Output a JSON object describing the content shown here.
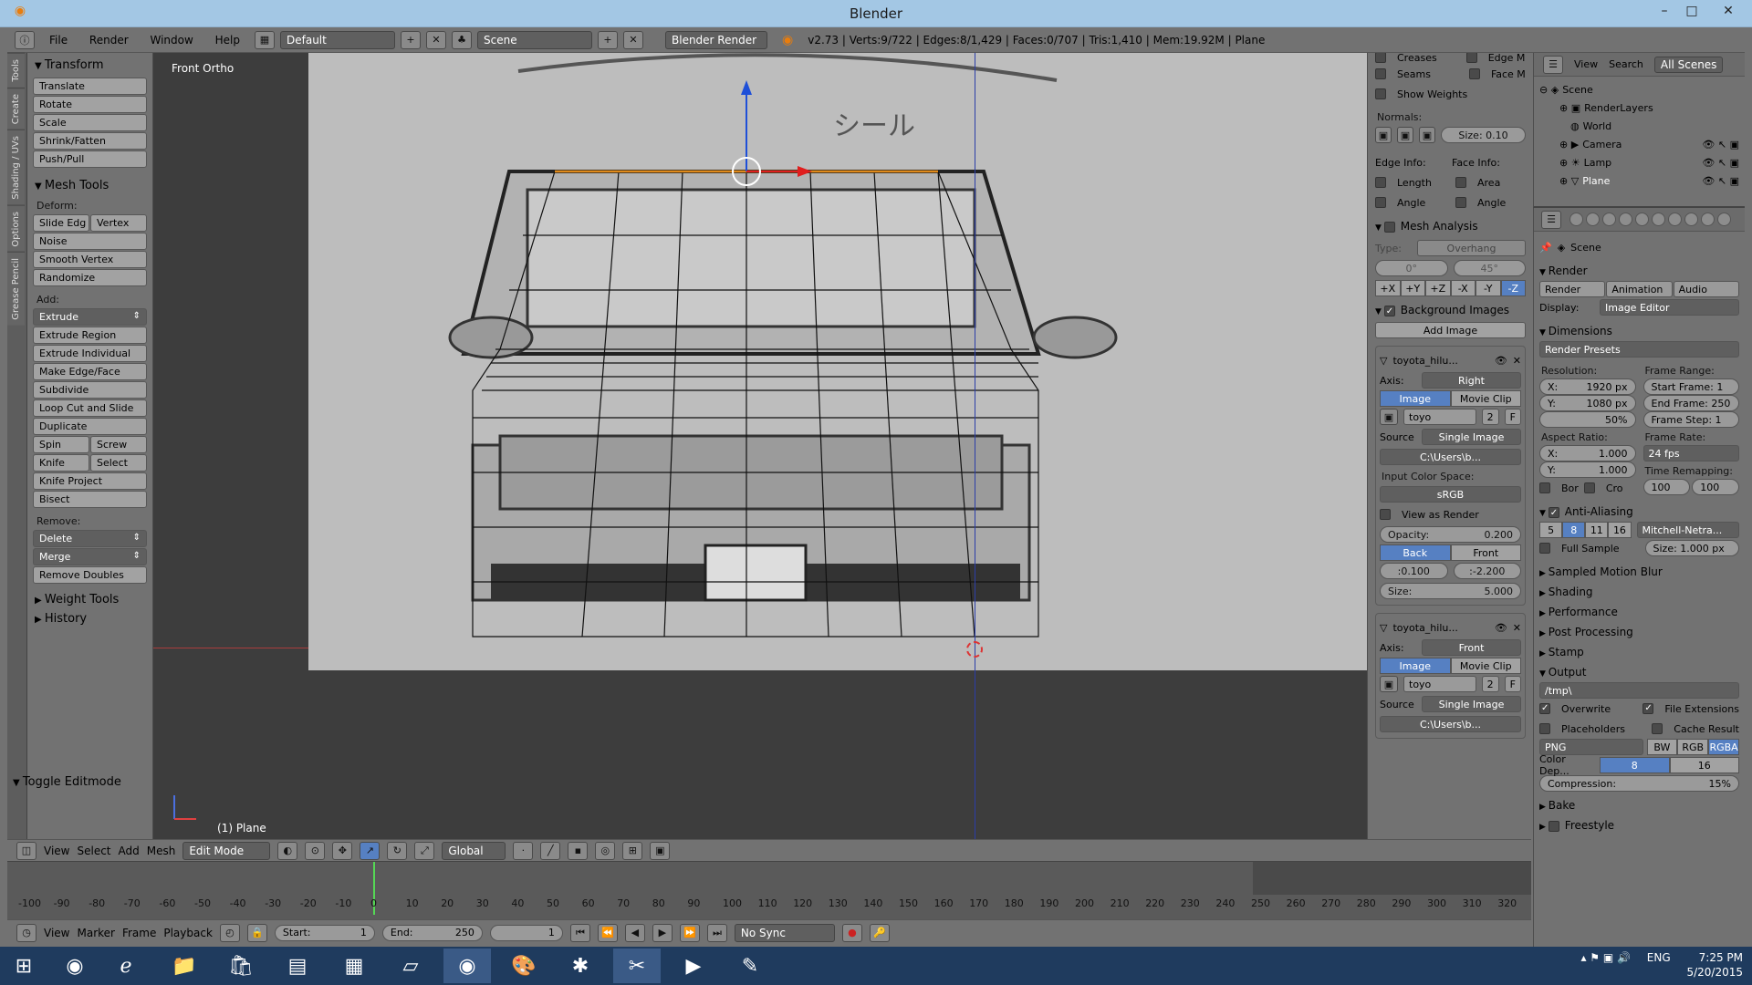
{
  "window": {
    "title": "Blender"
  },
  "infobar": {
    "menus": [
      "File",
      "Render",
      "Window",
      "Help"
    ],
    "layout": "Default",
    "scene": "Scene",
    "engine": "Blender Render",
    "stats": "v2.73 | Verts:9/722 | Edges:8/1,429 | Faces:0/707 | Tris:1,410 | Mem:19.92M | Plane"
  },
  "left_tabs": [
    "Tools",
    "Create",
    "Shading / UVs",
    "Options",
    "Grease Pencil"
  ],
  "toolshelf": {
    "transform_title": "Transform",
    "transform": [
      "Translate",
      "Rotate",
      "Scale",
      "Shrink/Fatten",
      "Push/Pull"
    ],
    "mesh_tools_title": "Mesh Tools",
    "deform_label": "Deform:",
    "deform_row": [
      "Slide Edg",
      "Vertex"
    ],
    "deform": [
      "Noise",
      "Smooth Vertex",
      "Randomize"
    ],
    "add_label": "Add:",
    "extrude": "Extrude",
    "add": [
      "Extrude Region",
      "Extrude Individual",
      "Make Edge/Face",
      "Subdivide",
      "Loop Cut and Slide",
      "Duplicate"
    ],
    "spin_row": [
      "Spin",
      "Screw"
    ],
    "knife_row": [
      "Knife",
      "Select"
    ],
    "add2": [
      "Knife Project",
      "Bisect"
    ],
    "remove_label": "Remove:",
    "delete": "Delete",
    "merge": "Merge",
    "remove_doubles": "Remove Doubles",
    "weight_tools": "Weight Tools",
    "history": "History",
    "toggle_editmode": "Toggle Editmode"
  },
  "viewport": {
    "view_label": "Front Ortho",
    "object_label": "(1) Plane",
    "image_text": "シール"
  },
  "npanel": {
    "creases": "Creases",
    "edge_m": "Edge M",
    "seams": "Seams",
    "face_m": "Face M",
    "show_weights": "Show Weights",
    "normals": "Normals:",
    "normal_size": "Size:  0.10",
    "edge_info": "Edge Info:",
    "face_info": "Face Info:",
    "length": "Length",
    "area": "Area",
    "angle": "Angle",
    "angle2": "Angle",
    "mesh_analysis": "Mesh Analysis",
    "type_label": "Type:",
    "type_value": "Overhang",
    "range_min": "0°",
    "range_max": "45°",
    "axes": [
      "+X",
      "+Y",
      "+Z",
      "-X",
      "-Y",
      "-Z"
    ],
    "bg_images": "Background Images",
    "add_image": "Add Image",
    "bg1": {
      "name": "toyota_hilu...",
      "axis_label": "Axis:",
      "axis": "Right",
      "tabs": [
        "Image",
        "Movie Clip"
      ],
      "img": "toyo",
      "users": "2",
      "f": "F",
      "source_label": "Source",
      "source": "Single Image",
      "path": "C:\\Users\\b...",
      "color_space_label": "Input Color Space:",
      "color_space": "sRGB",
      "view_as_render": "View as Render",
      "opacity": "Opacity:",
      "opacity_value": "0.200",
      "back": "Back",
      "front": "Front",
      "x": ":0.100",
      "y": ":-2.200",
      "size": "Size:",
      "size_value": "5.000"
    },
    "bg2": {
      "name": "toyota_hilu...",
      "axis_label": "Axis:",
      "axis": "Front",
      "tabs": [
        "Image",
        "Movie Clip"
      ],
      "img": "toyo",
      "users": "2",
      "f": "F",
      "source_label": "Source",
      "source": "Single Image",
      "path": "C:\\Users\\b..."
    }
  },
  "outliner": {
    "menus": [
      "View",
      "Search"
    ],
    "filter": "All Scenes",
    "items": [
      {
        "label": "Scene",
        "indent": 0
      },
      {
        "label": "RenderLayers",
        "indent": 1
      },
      {
        "label": "World",
        "indent": 1
      },
      {
        "label": "Camera",
        "indent": 1
      },
      {
        "label": "Lamp",
        "indent": 1
      },
      {
        "label": "Plane",
        "indent": 1
      }
    ]
  },
  "properties": {
    "context": "Scene",
    "render_title": "Render",
    "render_buttons": [
      "Render",
      "Animation",
      "Audio"
    ],
    "display_label": "Display:",
    "display": "Image Editor",
    "dimensions": "Dimensions",
    "presets": "Render Presets",
    "resolution": "Resolution:",
    "res_x": "1920 px",
    "res_y": "1080 px",
    "res_pct": "50%",
    "frame_range": "Frame Range:",
    "start_frame": "Start Frame: 1",
    "end_frame": "End Frame: 250",
    "frame_step": "Frame Step: 1",
    "aspect": "Aspect Ratio:",
    "asp_x": "1.000",
    "asp_y": "1.000",
    "frame_rate": "Frame Rate:",
    "fps": "24 fps",
    "time_remap": "Time Remapping:",
    "remap_old": "100",
    "remap_new": "100",
    "bor": "Bor",
    "cro": "Cro",
    "anti_aliasing": "Anti-Aliasing",
    "aa_samples": [
      "5",
      "8",
      "11",
      "16"
    ],
    "aa_filter": "Mitchell-Netra...",
    "full_sample": "Full Sample",
    "aa_size": "Size: 1.000 px",
    "collapsed": [
      "Sampled Motion Blur",
      "Shading",
      "Performance",
      "Post Processing",
      "Stamp"
    ],
    "output": "Output",
    "output_path": "/tmp\\",
    "overwrite": "Overwrite",
    "file_ext": "File Extensions",
    "placeholders": "Placeholders",
    "cache_result": "Cache Result",
    "format": "PNG",
    "color_modes": [
      "BW",
      "RGB",
      "RGBA"
    ],
    "color_depth": "Color Dep...",
    "depths": [
      "8",
      "16"
    ],
    "compression": "Compression:",
    "compression_value": "15%",
    "bake": "Bake",
    "freestyle": "Freestyle"
  },
  "vheader": {
    "menus": [
      "View",
      "Select",
      "Add",
      "Mesh"
    ],
    "mode": "Edit Mode",
    "orientation": "Global"
  },
  "timeline": {
    "ruler": [
      "-100",
      "-90",
      "-80",
      "-70",
      "-60",
      "-50",
      "-40",
      "-30",
      "-20",
      "-10",
      "0",
      "10",
      "20",
      "30",
      "40",
      "50",
      "60",
      "70",
      "80",
      "90",
      "100",
      "110",
      "120",
      "130",
      "140",
      "150",
      "160",
      "170",
      "180",
      "190",
      "200",
      "210",
      "220",
      "230",
      "240",
      "250",
      "260",
      "270",
      "280",
      "290",
      "300",
      "310",
      "320"
    ]
  },
  "tlheader": {
    "menus": [
      "View",
      "Marker",
      "Frame",
      "Playback"
    ],
    "start": "Start:",
    "start_v": "1",
    "end": "End:",
    "end_v": "250",
    "current": "1",
    "sync": "No Sync"
  },
  "tray": {
    "lang": "ENG",
    "time": "7:25 PM",
    "date": "5/20/2015"
  }
}
